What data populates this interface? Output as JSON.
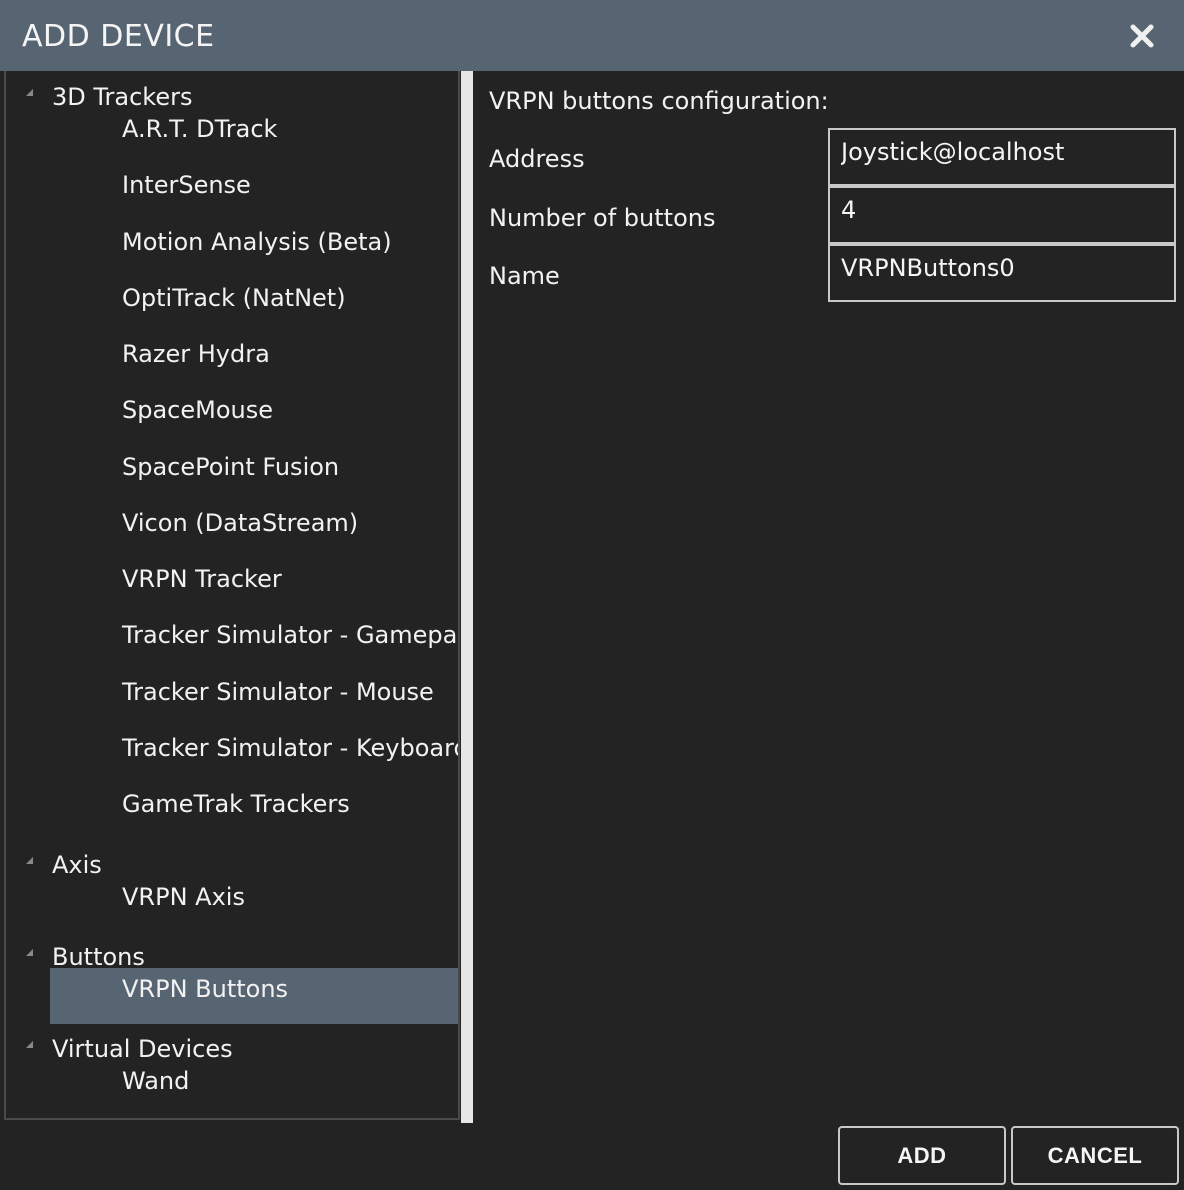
{
  "window": {
    "title": "ADD DEVICE",
    "close_icon": "close-icon"
  },
  "tree": {
    "groups": [
      {
        "label": "3D Trackers",
        "items": [
          "A.R.T. DTrack",
          "InterSense",
          "Motion Analysis (Beta)",
          "OptiTrack (NatNet)",
          "Razer Hydra",
          "SpaceMouse",
          "SpacePoint Fusion",
          "Vicon (DataStream)",
          "VRPN Tracker",
          "Tracker Simulator - Gamepad",
          "Tracker Simulator - Mouse",
          "Tracker Simulator - Keyboard",
          "GameTrak Trackers"
        ]
      },
      {
        "label": "Axis",
        "items": [
          "VRPN Axis"
        ]
      },
      {
        "label": "Buttons",
        "items": [
          "VRPN Buttons"
        ]
      },
      {
        "label": "Virtual Devices",
        "items": [
          "Wand"
        ]
      }
    ],
    "selected": "VRPN Buttons"
  },
  "config": {
    "title": "VRPN buttons configuration:",
    "fields": [
      {
        "label": "Address",
        "value": "Joystick@localhost"
      },
      {
        "label": "Number of buttons",
        "value": "4"
      },
      {
        "label": "Name",
        "value": "VRPNButtons0"
      }
    ]
  },
  "buttons": {
    "add": "ADD",
    "cancel": "CANCEL"
  },
  "colors": {
    "titlebar": "#576573",
    "background": "#232323",
    "selection": "#576573"
  }
}
